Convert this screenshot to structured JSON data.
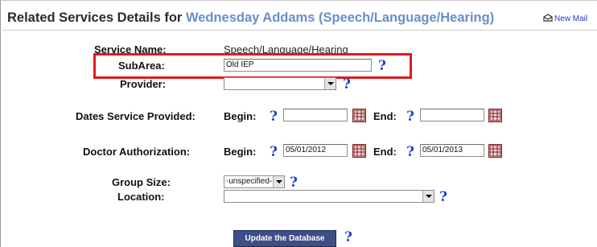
{
  "header": {
    "title_prefix": "Related Services Details for ",
    "student": "Wednesday Addams (Speech/Language/Hearing)",
    "new_mail": "New Mail"
  },
  "form": {
    "service_name_label": "Service Name:",
    "service_name_value": "Speech/Language/Hearing",
    "subarea_label": "SubArea:",
    "subarea_value": "Old IEP",
    "provider_label": "Provider:",
    "provider_value": "",
    "dates_label": "Dates Service Provided:",
    "dates_begin_label": "Begin:",
    "dates_begin_value": "",
    "dates_end_label": "End:",
    "dates_end_value": "",
    "auth_label": "Doctor Authorization:",
    "auth_begin_label": "Begin:",
    "auth_begin_value": "05/01/2012",
    "auth_end_label": "End:",
    "auth_end_value": "05/01/2013",
    "group_size_label": "Group Size:",
    "group_size_value": "-unspecified-",
    "location_label": "Location:",
    "location_value": "",
    "help_glyph": "?",
    "update_button": "Update the Database"
  },
  "colors": {
    "student_name": "#6a8fc7",
    "help_icon": "#2040d8",
    "highlight_box": "#e0191f",
    "button_bg": "#3d4f86"
  }
}
